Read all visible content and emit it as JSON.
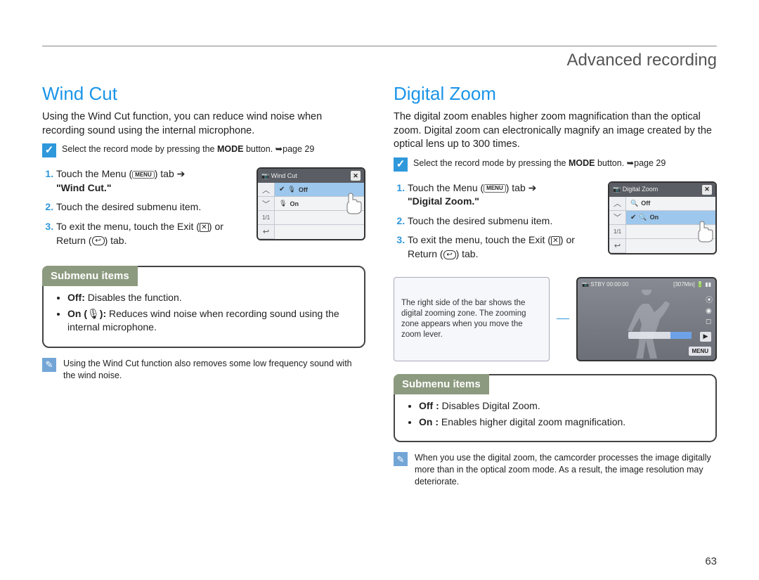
{
  "chapter": "Advanced recording",
  "pageNumber": "63",
  "windCut": {
    "title": "Wind Cut",
    "intro": "Using the Wind Cut function, you can reduce wind noise when recording sound using the internal microphone.",
    "precheck_a": "Select the record mode by pressing the ",
    "precheck_mode": "MODE",
    "precheck_b": " button. ➥page 29",
    "step1_a": "Touch the Menu (",
    "step1_menu": "MENU",
    "step1_b": ") tab ➔ ",
    "step1_quote": "\"Wind Cut.\"",
    "step2": "Touch the desired submenu item.",
    "step3_a": "To exit the menu, touch the Exit (",
    "step3_b": ") or Return (",
    "step3_c": ") tab.",
    "screenshot": {
      "title": "Wind Cut",
      "off": "Off",
      "on": "On"
    },
    "submenuLabel": "Submenu items",
    "sm_off_label": "Off:",
    "sm_off_text": " Disables the function.",
    "sm_on_label": "On (",
    "sm_on_label2": "):",
    "sm_on_text": " Reduces wind noise when recording sound using the internal microphone.",
    "note": "Using the Wind Cut function also removes some low frequency sound with the wind noise."
  },
  "digitalZoom": {
    "title": "Digital Zoom",
    "intro": "The digital zoom enables higher zoom magnification than the optical zoom. Digital zoom can electronically magnify an image created by the optical lens up to 300 times.",
    "precheck_a": "Select the record mode by pressing the ",
    "precheck_mode": "MODE",
    "precheck_b": " button. ➥page 29",
    "step1_a": "Touch the Menu (",
    "step1_menu": "MENU",
    "step1_b": ") tab ➔ ",
    "step1_quote": "\"Digital Zoom.\"",
    "step2": "Touch the desired submenu item.",
    "step3_a": "To exit the menu, touch the Exit (",
    "step3_b": ") or Return (",
    "step3_c": ") tab.",
    "screenshot": {
      "title": "Digital Zoom",
      "off": "Off",
      "on": "On"
    },
    "zoomNote": "The right side of the bar shows the digital zooming zone. The zooming zone appears when you move the zoom lever.",
    "preview": {
      "stby": "STBY",
      "time": "00:00:00",
      "remain": "[307Min]",
      "menu": "MENU"
    },
    "submenuLabel": "Submenu items",
    "sm_off_label": "Off :",
    "sm_off_text": " Disables Digital Zoom.",
    "sm_on_label": "On :",
    "sm_on_text": " Enables higher digital zoom magnification.",
    "note": "When you use the digital zoom, the camcorder processes the image digitally more than in the optical zoom mode. As a result, the image resolution may deteriorate."
  }
}
